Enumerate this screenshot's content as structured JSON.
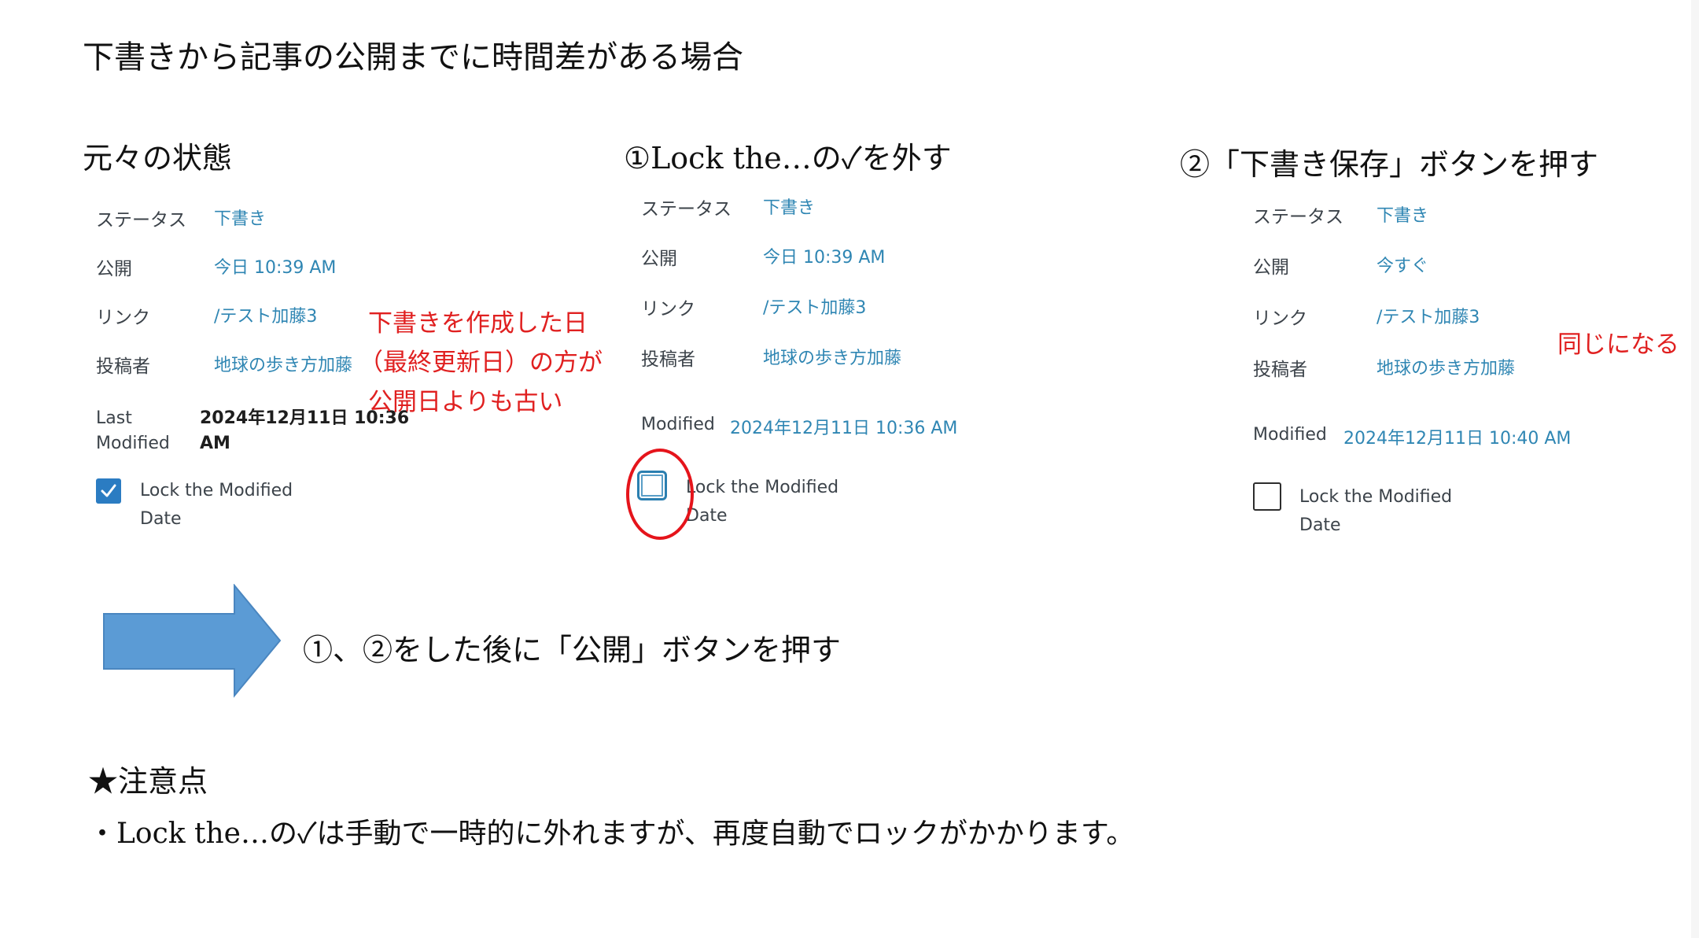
{
  "title": "下書きから記事の公開までに時間差がある場合",
  "panels": [
    {
      "heading": "元々の状態",
      "rows": [
        {
          "label": "ステータス",
          "value": "下書き"
        },
        {
          "label": "公開",
          "value": "今日 10:39 AM"
        },
        {
          "label": "リンク",
          "value": "/テスト加藤3"
        },
        {
          "label": "投稿者",
          "value": "地球の歩き方加藤"
        }
      ],
      "modified_label_line1": "Last",
      "modified_label_line2": "Modified",
      "modified_value_line1": "2024年12月11日 10:36",
      "modified_value_line2": "AM",
      "checkbox_checked": true,
      "checkbox_label_line1": "Lock the Modified",
      "checkbox_label_line2": "Date",
      "annotation": [
        "下書きを作成した日",
        "（最終更新日）の方が",
        "公開日よりも古い"
      ]
    },
    {
      "heading": "①Lock the…の✓を外す",
      "rows": [
        {
          "label": "ステータス",
          "value": "下書き"
        },
        {
          "label": "公開",
          "value": "今日 10:39 AM"
        },
        {
          "label": "リンク",
          "value": "/テスト加藤3"
        },
        {
          "label": "投稿者",
          "value": "地球の歩き方加藤"
        }
      ],
      "modified_label": "Modified",
      "modified_value": "2024年12月11日 10:36 AM",
      "checkbox_checked": false,
      "checkbox_label_line1": "Lock the Modified",
      "checkbox_label_line2": "Date"
    },
    {
      "heading": "②「下書き保存」ボタンを押す",
      "rows": [
        {
          "label": "ステータス",
          "value": "下書き"
        },
        {
          "label": "公開",
          "value": "今すぐ"
        },
        {
          "label": "リンク",
          "value": "/テスト加藤3"
        },
        {
          "label": "投稿者",
          "value": "地球の歩き方加藤"
        }
      ],
      "modified_label": "Modified",
      "modified_value": "2024年12月11日 10:40 AM",
      "checkbox_checked": false,
      "checkbox_label_line1": "Lock the Modified",
      "checkbox_label_line2": "Date",
      "annotation": "同じになる"
    }
  ],
  "arrow_step": {
    "icon": "right-arrow-icon",
    "text": "①、②をした後に「公開」ボタンを押す"
  },
  "notes": {
    "heading": "★注意点",
    "line": "・Lock the…の✓は手動で一時的に外れますが、再度自動でロックがかかります。"
  },
  "colors": {
    "link_blue": "#2f86b3",
    "annotation_red": "#e02020",
    "checkbox_blue": "#2b7cc2",
    "arrow_blue": "#5b9bd5"
  }
}
